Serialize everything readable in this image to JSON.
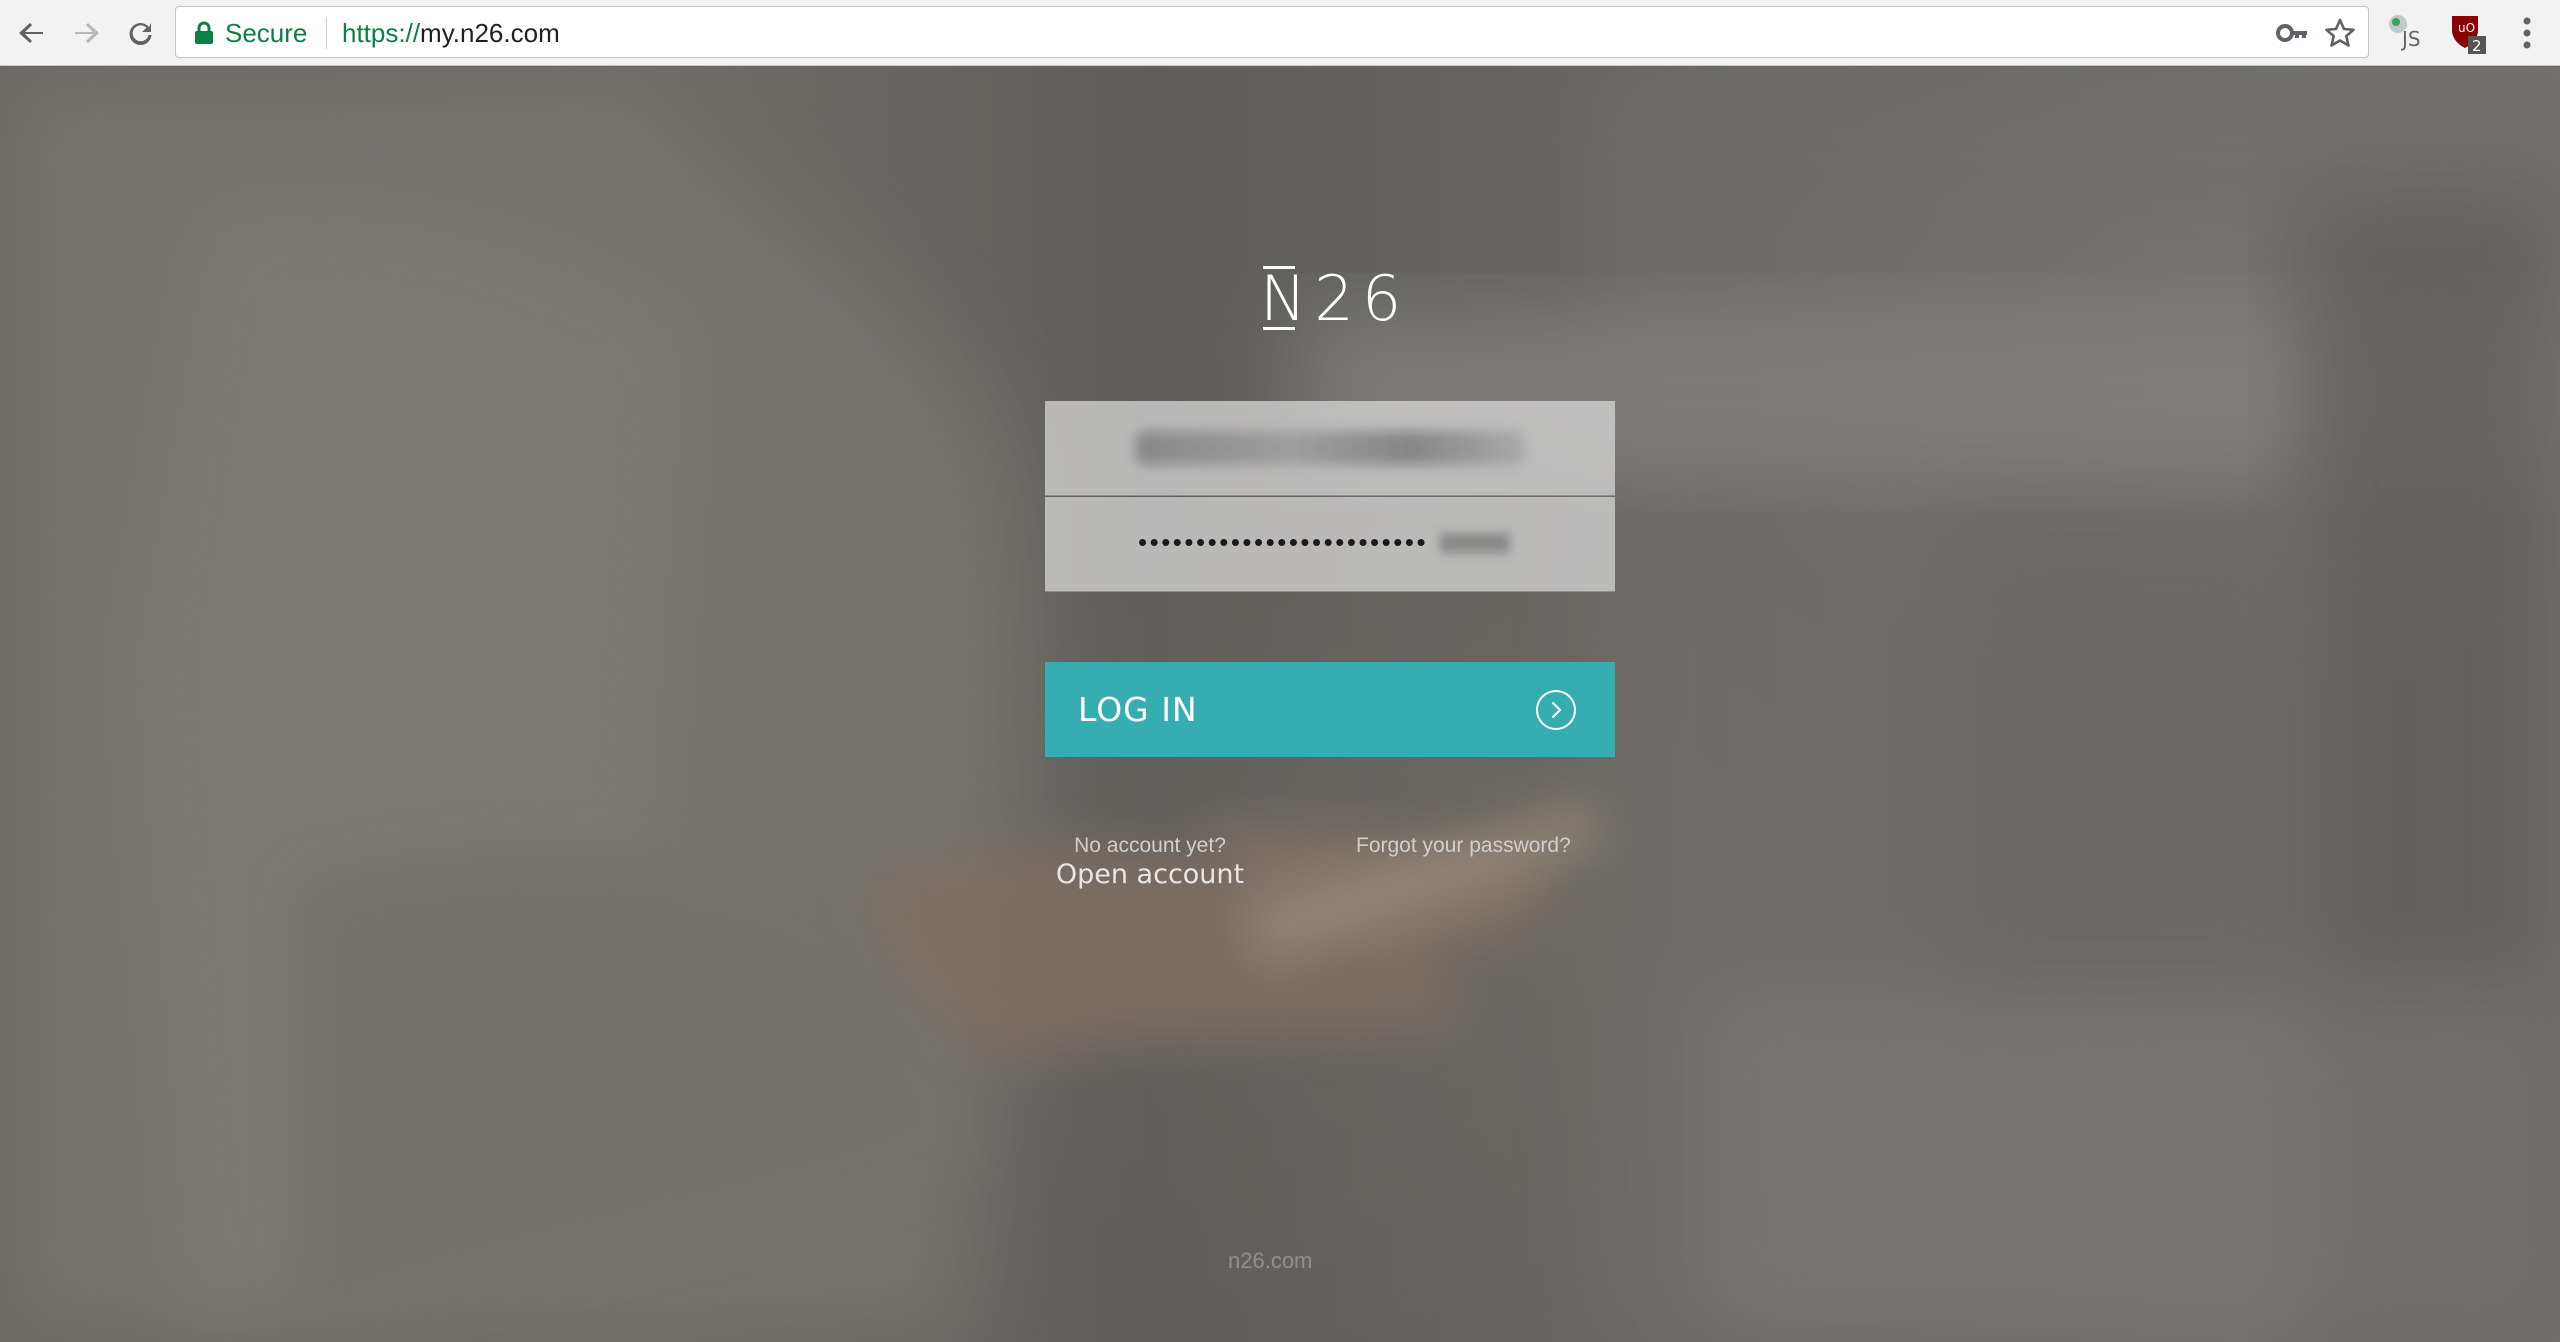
{
  "browser": {
    "security_label": "Secure",
    "url_scheme": "https://",
    "url_host": "my.n26.com",
    "icons": {
      "back": "arrow-left-icon",
      "forward": "arrow-right-icon",
      "reload": "reload-icon",
      "lock": "lock-icon",
      "key": "key-icon",
      "bookmark": "star-icon",
      "extension_js": "js-extension-icon",
      "extension_ublock": "ublock-icon",
      "menu": "kebab-menu-icon"
    },
    "ublock_badge": "2",
    "extension_js_label": "JS",
    "colors": {
      "secure_green": "#0b8043"
    }
  },
  "login": {
    "logo_text": "N26",
    "email_value": "",
    "password_mask": "•••••••••••••••••••••••••",
    "submit_label": "LOG IN",
    "submit_icon": "arrow-circle-right-icon",
    "no_account_hint": "No account yet?",
    "open_account_label": "Open account",
    "forgot_password_label": "Forgot your password?",
    "colors": {
      "button_teal": "#36aeb1"
    }
  },
  "footer": {
    "domain": "n26.com"
  }
}
